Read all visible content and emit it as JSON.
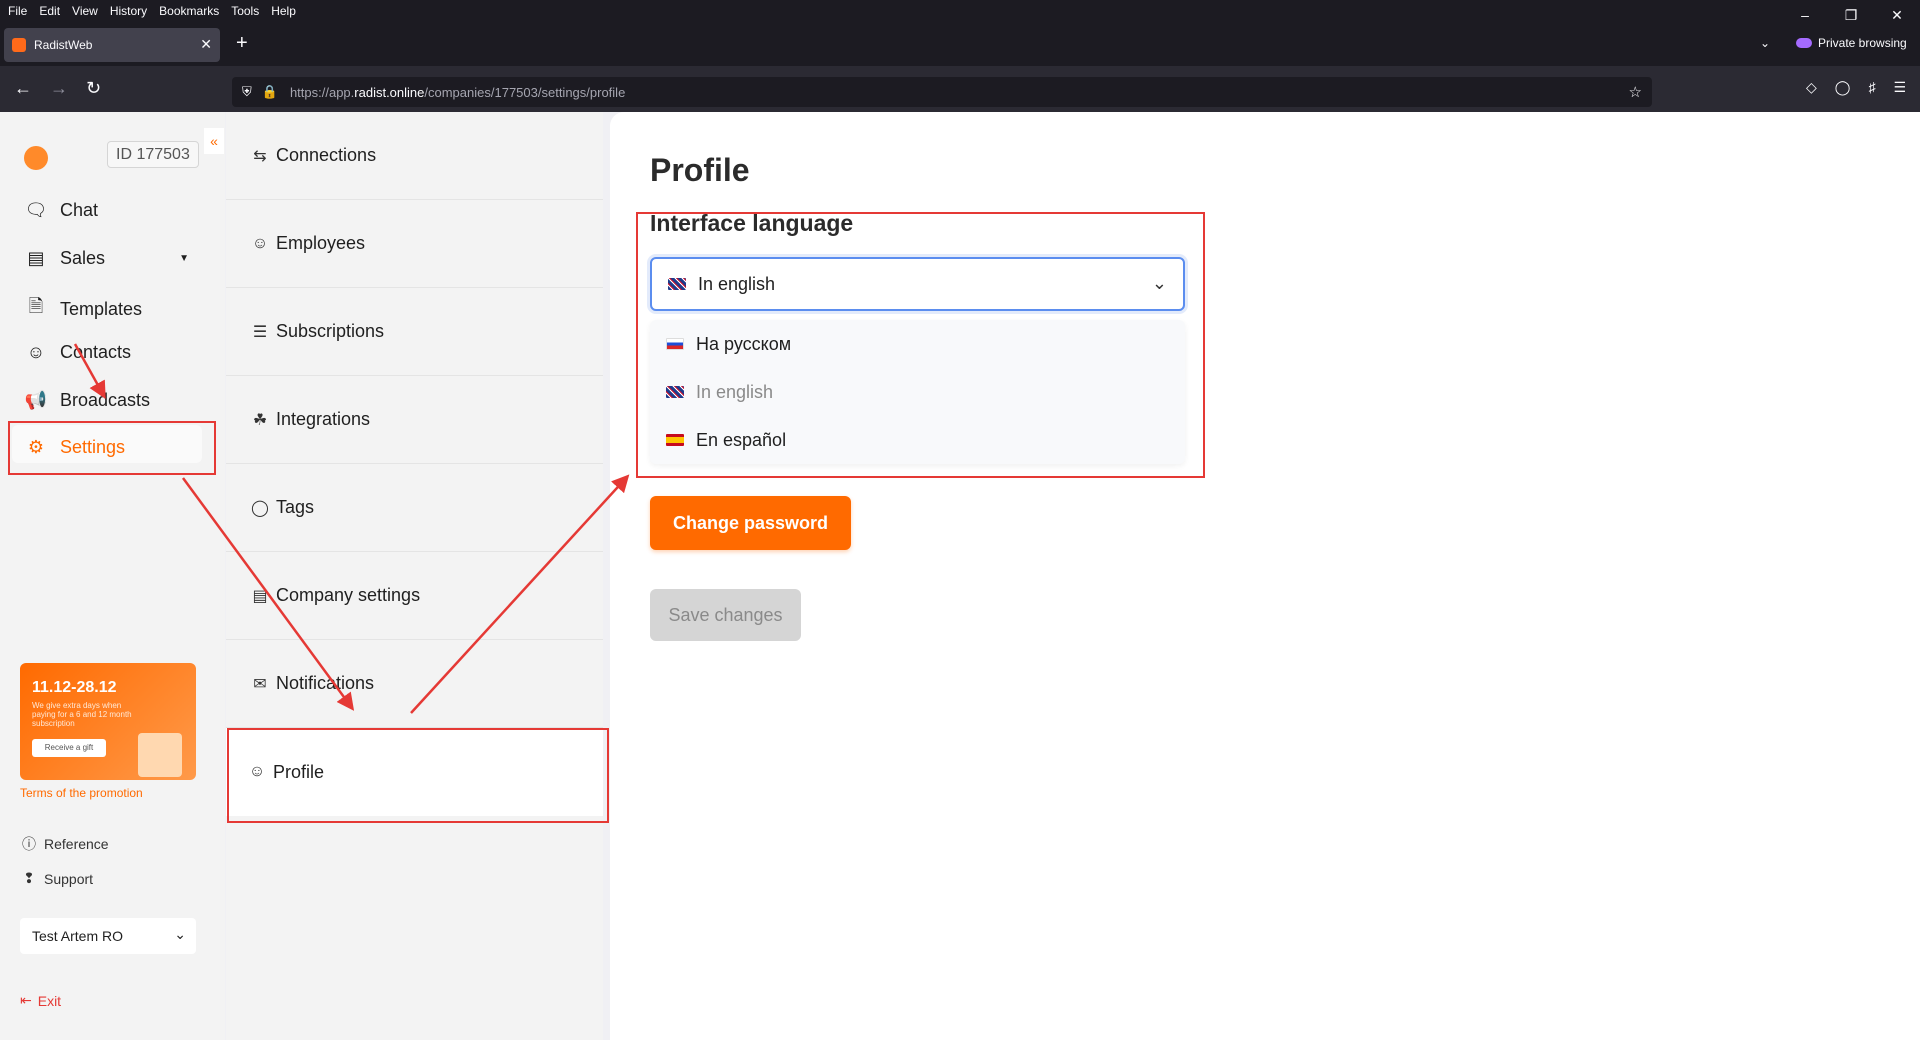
{
  "browser": {
    "menu": [
      "File",
      "Edit",
      "View",
      "History",
      "Bookmarks",
      "Tools",
      "Help"
    ],
    "tab_title": "RadistWeb",
    "url_prefix": "https://app.",
    "url_domain": "radist.online",
    "url_path": "/companies/177503/settings/profile",
    "private_label": "Private browsing"
  },
  "sidebar": {
    "company_id": "ID 177503",
    "items": [
      {
        "label": "Chat",
        "icon": "chat-icon"
      },
      {
        "label": "Sales",
        "icon": "store-icon"
      },
      {
        "label": "Templates",
        "icon": "document-icon"
      },
      {
        "label": "Contacts",
        "icon": "users-icon"
      },
      {
        "label": "Broadcasts",
        "icon": "megaphone-icon"
      },
      {
        "label": "Settings",
        "icon": "gear-icon"
      }
    ],
    "promo": {
      "date": "11.12-28.12",
      "text": "We give extra days when paying for a 6 and 12 month subscription",
      "button": "Receive a gift",
      "terms": "Terms of the promotion"
    },
    "reference": "Reference",
    "support": "Support",
    "user": "Test Artem RO",
    "exit": "Exit"
  },
  "settings_menu": {
    "items": [
      {
        "label": "Connections",
        "icon": "swap-icon"
      },
      {
        "label": "Employees",
        "icon": "users-icon"
      },
      {
        "label": "Subscriptions",
        "icon": "subscriptions-icon"
      },
      {
        "label": "Integrations",
        "icon": "puzzle-icon"
      },
      {
        "label": "Tags",
        "icon": "tag-icon"
      },
      {
        "label": "Company settings",
        "icon": "briefcase-icon"
      },
      {
        "label": "Notifications",
        "icon": "mail-icon"
      },
      {
        "label": "Profile",
        "icon": "profile-icon"
      }
    ]
  },
  "main": {
    "title": "Profile",
    "language_label": "Interface language",
    "selected_language": "In english",
    "options": [
      {
        "label": "На русском",
        "flag": "ru"
      },
      {
        "label": "In english",
        "flag": "gb"
      },
      {
        "label": "En español",
        "flag": "es"
      }
    ],
    "change_password": "Change password",
    "save_changes": "Save changes"
  },
  "colors": {
    "accent": "#ff6a00",
    "annotation": "#e53935",
    "focus": "#5b8def"
  }
}
